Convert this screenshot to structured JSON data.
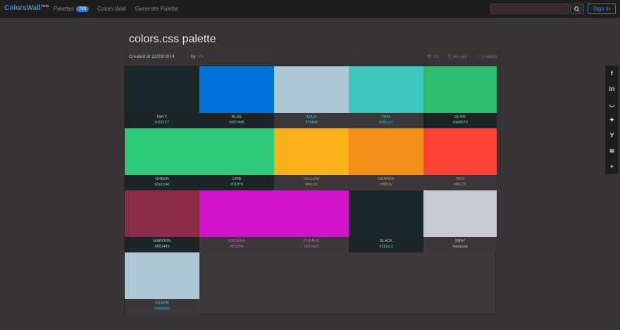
{
  "navbar": {
    "brand": "ColorsWall",
    "brand_badge": "beta",
    "links": [
      {
        "label": "Palettes",
        "badge": "789"
      },
      {
        "label": "Colors Wall"
      },
      {
        "label": "Generate Palette"
      }
    ],
    "search_placeholder": "",
    "signin_label": "Sign in"
  },
  "header": {
    "title": "colors.css palette",
    "created": "Created at 12/29/2014",
    "by_label": "by",
    "author": "ms",
    "stats": [
      "13",
      "34 copy",
      "3 saved"
    ]
  },
  "palette": {
    "colors": [
      {
        "name": "NAVY",
        "hex": "#1f2127",
        "swatch": "#1b262b",
        "info_bg": "#1c2428",
        "info_text": "#8fd4c0"
      },
      {
        "name": "BLUE",
        "hex": "#0074d9",
        "swatch": "#0074d9",
        "info_bg": "#1c2428",
        "info_text": "#8fd4c0"
      },
      {
        "name": "AQUA",
        "hex": "#7fdbff",
        "swatch": "#aec7d4",
        "info_bg": "#3d373b",
        "info_text": "#2fc6e4"
      },
      {
        "name": "TEAL",
        "hex": "#39cccc",
        "swatch": "#3fc7c2",
        "info_bg": "#3d373b",
        "info_text": "#2fc6e4"
      },
      {
        "name": "OLIVE",
        "hex": "#3d9970",
        "swatch": "#2ebd6e",
        "info_bg": "#1c2428",
        "info_text": "#8fd4c0"
      },
      {
        "name": "GREEN",
        "hex": "#2ecc40",
        "swatch": "#2ecc7a",
        "info_bg": "#1c2428",
        "info_text": "#8fd4c0"
      },
      {
        "name": "LIME",
        "hex": "#01ff70",
        "swatch": "#2ecc7a",
        "info_bg": "#1c2428",
        "info_text": "#8fd4c0"
      },
      {
        "name": "YELLOW",
        "hex": "#ffdc00",
        "swatch": "#fcb01a",
        "info_bg": "#3d373b",
        "info_text": "#b79a62"
      },
      {
        "name": "ORANGE",
        "hex": "#ff851b",
        "swatch": "#f39018",
        "info_bg": "#3d373b",
        "info_text": "#b79a62"
      },
      {
        "name": "RED",
        "hex": "#ff4136",
        "swatch": "#ff4238",
        "info_bg": "#3d373b",
        "info_text": "#b79a62"
      },
      {
        "name": "MAROON",
        "hex": "#85144b",
        "swatch": "#8a2e48",
        "info_bg": "#1c2428",
        "info_text": "#8fd4c0"
      },
      {
        "name": "FUCHSIA",
        "hex": "#f012be",
        "swatch": "#d012c8",
        "info_bg": "#3d373b",
        "info_text": "#b86cc4"
      },
      {
        "name": "PURPLE",
        "hex": "#b10dc9",
        "swatch": "#d012c8",
        "info_bg": "#3d373b",
        "info_text": "#b86cc4"
      },
      {
        "name": "BLACK",
        "hex": "#111111",
        "swatch": "#1b262b",
        "info_bg": "#1c2428",
        "info_text": "#8fd4c0"
      },
      {
        "name": "GRAY",
        "hex": "#aaaaaa",
        "swatch": "#c5c9d2",
        "info_bg": "#3d373b",
        "info_text": "#b7bfb0"
      },
      {
        "name": "SILVER",
        "hex": "#dddddd",
        "swatch": "#aec7d4",
        "info_bg": "#3d373b",
        "info_text": "#2fc6e4"
      }
    ]
  },
  "share": {
    "items": [
      {
        "icon": "facebook-icon",
        "glyph": "f"
      },
      {
        "icon": "linkedin-icon",
        "glyph": "in"
      },
      {
        "icon": "pocket-icon",
        "glyph": "◡"
      },
      {
        "icon": "twitter-icon",
        "glyph": "✦"
      },
      {
        "icon": "hacker-news-icon",
        "glyph": "Y"
      },
      {
        "icon": "buffer-icon",
        "glyph": "≋"
      },
      {
        "icon": "more-icon",
        "glyph": "+"
      }
    ]
  }
}
